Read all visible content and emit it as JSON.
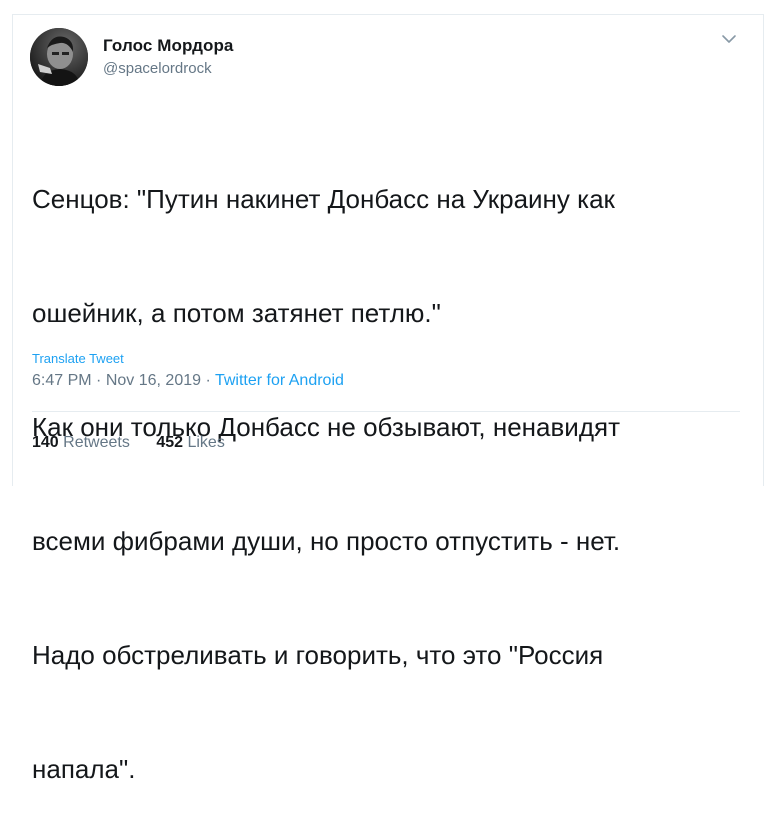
{
  "author": {
    "display_name": "Голос Мордора",
    "handle": "@spacelordrock",
    "avatar_icon": "user-avatar-photo"
  },
  "tweet": {
    "lines": [
      "Сенцов: \"Путин накинет Донбасс на Украину как",
      "ошейник, а потом затянет петлю.\"",
      "Как они только Донбасс не обзывают, ненавидят",
      "всеми фибрами души, но просто отпустить - нет.",
      "Надо обстреливать и говорить, что это \"Россия",
      "напала\"."
    ],
    "translate_label": "Translate Tweet",
    "time": "6:47 PM",
    "separator": "·",
    "date": "Nov 16, 2019",
    "source": "Twitter for Android"
  },
  "stats": {
    "retweets_count": "140",
    "retweets_label": "Retweets",
    "likes_count": "452",
    "likes_label": "Likes"
  },
  "colors": {
    "link": "#1da1f2",
    "secondary_text": "#657786",
    "primary_text": "#14171a",
    "divider": "#e6ecf0"
  },
  "icons": {
    "menu": "chevron-down-icon"
  }
}
